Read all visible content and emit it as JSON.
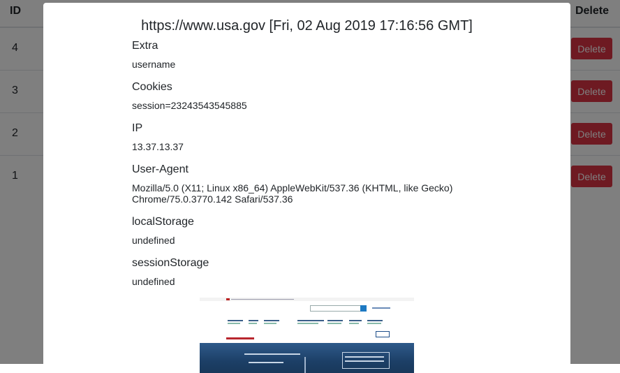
{
  "table": {
    "header": {
      "id": "ID",
      "delete": "Delete"
    },
    "rows": [
      {
        "id": "4",
        "delete_label": "Delete"
      },
      {
        "id": "3",
        "delete_label": "Delete"
      },
      {
        "id": "2",
        "delete_label": "Delete"
      },
      {
        "id": "1",
        "delete_label": "Delete"
      }
    ]
  },
  "modal": {
    "title": "https://www.usa.gov [Fri, 02 Aug 2019 17:16:56 GMT]",
    "fields": [
      {
        "label": "Extra",
        "value": "username"
      },
      {
        "label": "Cookies",
        "value": "session=23243543545885"
      },
      {
        "label": "IP",
        "value": "13.37.13.37"
      },
      {
        "label": "User-Agent",
        "value": "Mozilla/5.0 (X11; Linux x86_64) AppleWebKit/537.36 (KHTML, like Gecko) Chrome/75.0.3770.142 Safari/537.36"
      },
      {
        "label": "localStorage",
        "value": "undefined"
      },
      {
        "label": "sessionStorage",
        "value": "undefined"
      }
    ]
  },
  "colors": {
    "danger": "#dc3545",
    "backdrop": "rgba(0,0,0,0.5)"
  }
}
